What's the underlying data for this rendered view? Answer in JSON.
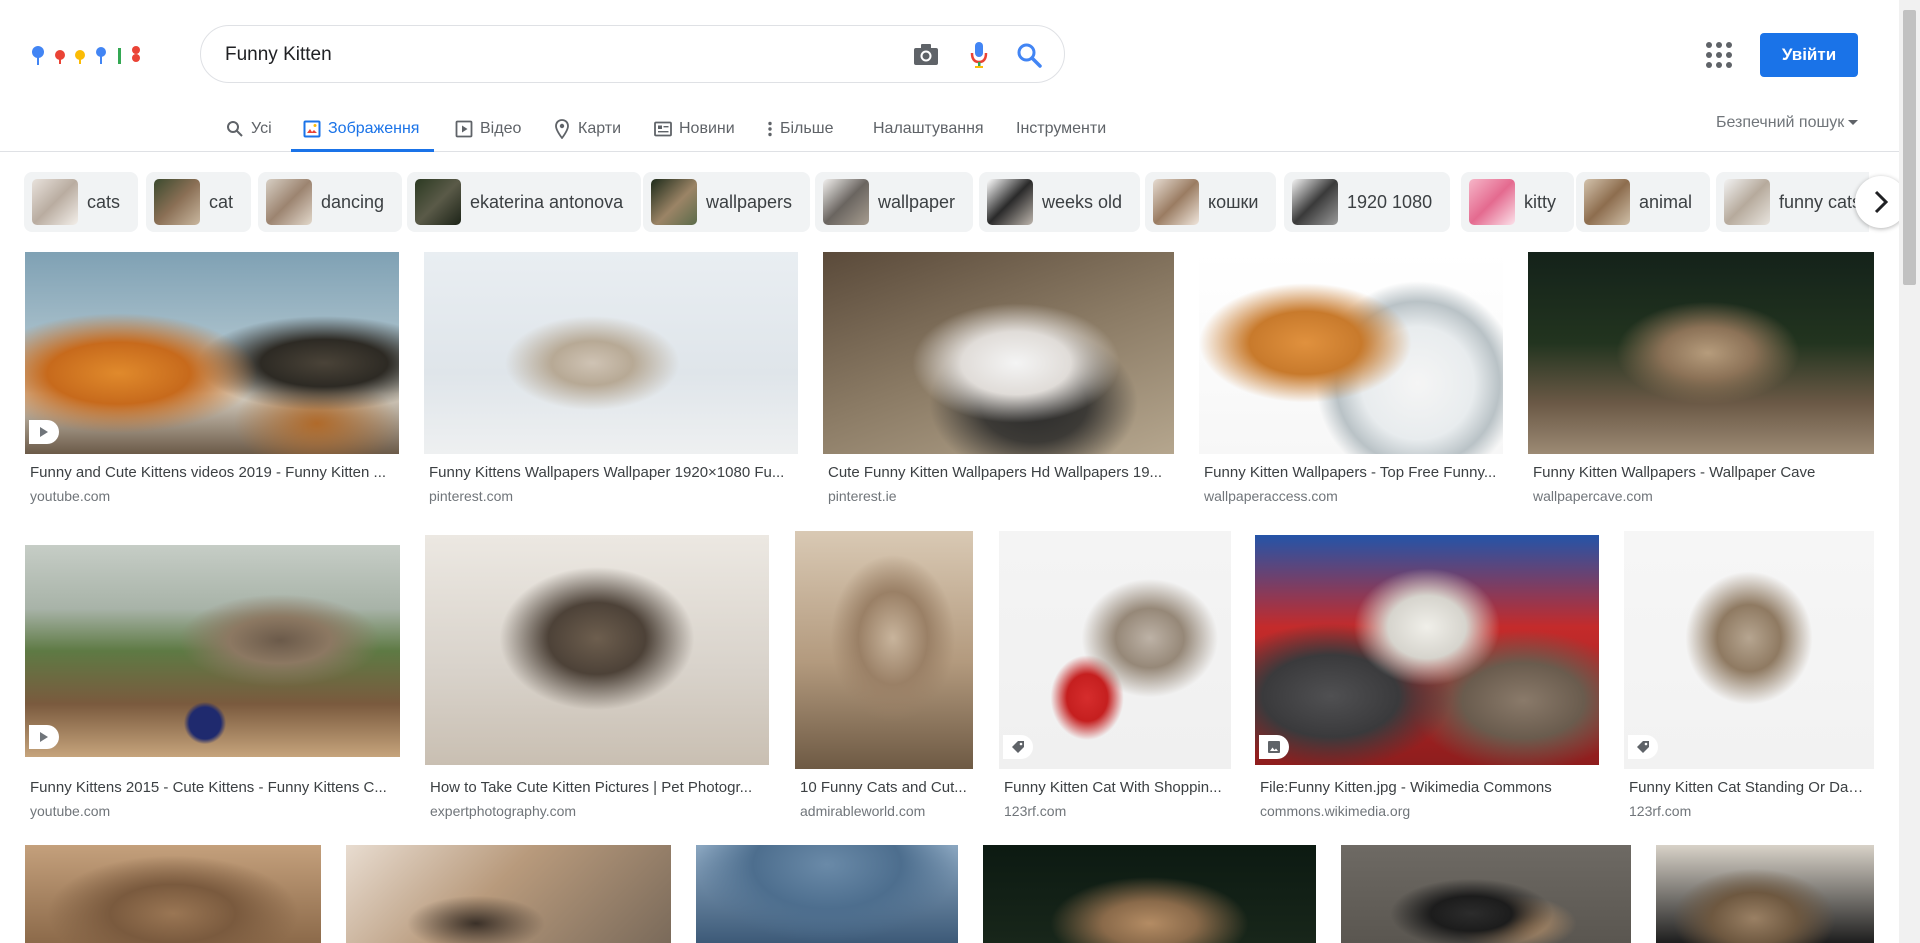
{
  "header": {
    "logo_alt": "Google",
    "search": {
      "value": "Funny Kitten",
      "placeholder": ""
    },
    "icons": {
      "camera": "camera-icon",
      "mic": "mic-icon",
      "search": "search-icon",
      "apps": "apps-grid-icon"
    },
    "signin_label": "Увійти"
  },
  "tabs": [
    {
      "label": "Усі",
      "icon": "search-icon",
      "active": false
    },
    {
      "label": "Зображення",
      "icon": "image-icon",
      "active": true
    },
    {
      "label": "Відео",
      "icon": "video-icon",
      "active": false
    },
    {
      "label": "Карти",
      "icon": "map-pin-icon",
      "active": false
    },
    {
      "label": "Новини",
      "icon": "news-icon",
      "active": false
    },
    {
      "label": "Більше",
      "icon": "more-vert-icon",
      "active": false
    },
    {
      "label": "Налаштування"
    },
    {
      "label": "Інструменти"
    }
  ],
  "safe_search_label": "Безпечний пошук",
  "chips": [
    {
      "label": "cats"
    },
    {
      "label": "cat"
    },
    {
      "label": "dancing"
    },
    {
      "label": "ekaterina antonova"
    },
    {
      "label": "wallpapers"
    },
    {
      "label": "wallpaper"
    },
    {
      "label": "weeks old"
    },
    {
      "label": "кошки"
    },
    {
      "label": "1920 1080"
    },
    {
      "label": "kitty"
    },
    {
      "label": "animal"
    },
    {
      "label": "funny cats"
    }
  ],
  "results": [
    {
      "title": "Funny and Cute Kittens videos 2019 - Funny Kitten ...",
      "site": "youtube.com",
      "badge": "play-icon"
    },
    {
      "title": "Funny Kittens Wallpapers Wallpaper 1920×1080 Fu...",
      "site": "pinterest.com"
    },
    {
      "title": "Cute Funny Kitten Wallpapers Hd Wallpapers 19...",
      "site": "pinterest.ie"
    },
    {
      "title": "Funny Kitten Wallpapers - Top Free Funny...",
      "site": "wallpaperaccess.com"
    },
    {
      "title": "Funny Kitten Wallpapers - Wallpaper Cave",
      "site": "wallpapercave.com"
    },
    {
      "title": "Funny Kittens 2015 - Cute Kittens - Funny Kittens C...",
      "site": "youtube.com",
      "badge": "play-icon"
    },
    {
      "title": "How to Take Cute Kitten Pictures | Pet Photogr...",
      "site": "expertphotography.com"
    },
    {
      "title": "10 Funny Cats and Cut...",
      "site": "admirableworld.com"
    },
    {
      "title": "Funny Kitten Cat With Shoppin...",
      "site": "123rf.com",
      "badge": "tag-icon"
    },
    {
      "title": "File:Funny Kitten.jpg - Wikimedia Commons",
      "site": "commons.wikimedia.org",
      "badge": "image-icon"
    },
    {
      "title": "Funny Kitten Cat Standing Or Dan...",
      "site": "123rf.com",
      "badge": "tag-icon"
    },
    {
      "title": "",
      "site": ""
    },
    {
      "title": "",
      "site": ""
    },
    {
      "title": "",
      "site": ""
    },
    {
      "title": "",
      "site": ""
    },
    {
      "title": "",
      "site": ""
    },
    {
      "title": "",
      "site": ""
    }
  ],
  "colors": {
    "accent": "#1a73e8",
    "chip_bg": "#f1f3f4",
    "text_muted": "#70757a"
  }
}
